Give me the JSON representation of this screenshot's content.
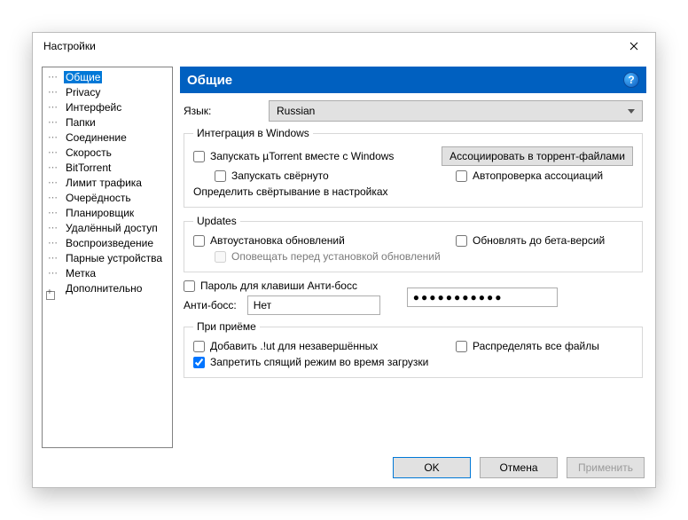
{
  "window": {
    "title": "Настройки"
  },
  "tree": {
    "items": [
      "Общие",
      "Privacy",
      "Интерфейс",
      "Папки",
      "Соединение",
      "Скорость",
      "BitTorrent",
      "Лимит трафика",
      "Очерёдность",
      "Планировщик",
      "Удалённый доступ",
      "Воспроизведение",
      "Парные устройства",
      "Метка",
      "Дополнительно"
    ],
    "selectedIndex": 0,
    "expandableIndex": 14
  },
  "header": {
    "title": "Общие",
    "help": "?"
  },
  "language": {
    "label": "Язык:",
    "value": "Russian"
  },
  "groups": {
    "winIntegration": {
      "legend": "Интеграция в Windows",
      "startWithWindows": "Запускать µTorrent вместе с Windows",
      "startMinimized": "Запускать свёрнуто",
      "assocButton": "Ассоциировать в торрент-файлами",
      "autoCheckAssoc": "Автопроверка ассоциаций",
      "defineMinimize": "Определить свёртывание в настройках"
    },
    "updates": {
      "legend": "Updates",
      "autoInstall": "Автоустановка обновлений",
      "beta": "Обновлять до бета-версий",
      "notifyBefore": "Оповещать перед установкой обновлений"
    },
    "password": {
      "enable": "Пароль для клавиши Анти-босс",
      "label": "Анти-босс:",
      "value": "Нет",
      "masked": "●●●●●●●●●●●"
    },
    "onReceive": {
      "legend": "При приёме",
      "addUt": "Добавить .!ut для незавершённых",
      "preAlloc": "Распределять все файлы",
      "preventSleep": "Запретить спящий режим во время загрузки"
    }
  },
  "footer": {
    "ok": "OK",
    "cancel": "Отмена",
    "apply": "Применить"
  }
}
